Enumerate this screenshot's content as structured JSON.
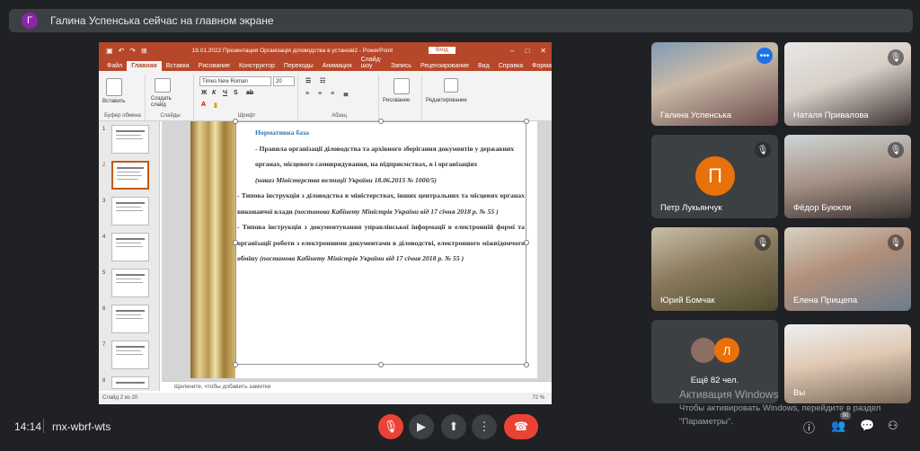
{
  "banner": {
    "avatar_letter": "Г",
    "text": "Галина Успенська сейчас на главном экране"
  },
  "powerpoint": {
    "title": "19.01.2022 Презентация Організація діловодства в установі2 - PowerPoint",
    "login_label": "Вход",
    "tabs": [
      "Файл",
      "Главная",
      "Вставка",
      "Рисование",
      "Конструктор",
      "Переходы",
      "Анимация",
      "Слайд-шоу",
      "Запись",
      "Рецензирование",
      "Вид",
      "Справка",
      "Формат"
    ],
    "active_tab": "Главная",
    "ribbon": {
      "paste_label": "Вставить",
      "clipboard_label": "Буфер обмена",
      "new_slide_label": "Создать слайд",
      "slides_label": "Слайды",
      "font_name": "Times New Roman",
      "font_size": "20",
      "font_label": "Шрифт",
      "paragraph_label": "Абзац",
      "drawing_label": "Рисование",
      "editing_label": "Редактирование"
    },
    "thumbnails": [
      "1",
      "2",
      "3",
      "4",
      "5",
      "6",
      "7",
      "8"
    ],
    "selected_slide": "2",
    "slide": {
      "heading": "Нормативна база",
      "p1": "- Правила організації діловодства та архівного зберігання документів у державних органах, місцевого самоврядування, на підприємствах, в і організаціях",
      "p1_italic": "(наказ Міністерства юстиції України 18.06.2015 № 1000/5)",
      "p2": "- Типова інструкція з діловодства в міністерствах, інших центральних та місцевих органах виконавчої влади",
      "p2_italic": "(постанова Кабінету Міністрів України від 17 січня 2018 р. № 55 )",
      "p3": "- Типова інструкція з документування управлінської інформації в електронній формі та організації роботи з електронними документами в діловодстві, електронного міжвідомчого обміну",
      "p3_italic": "(постанова Кабінету Міністрів України від 17 січня 2018 р. № 55 )"
    },
    "notes_placeholder": "Щелкните, чтобы добавить заметки",
    "status_text": "Слайд 2 из 20",
    "zoom": "72 %"
  },
  "participants": [
    {
      "name": "Галина Успенська",
      "state": "presenting"
    },
    {
      "name": "Наталя Привалова",
      "state": "muted"
    },
    {
      "name": "Петр Лукьянчук",
      "avatar": "П",
      "state": "muted"
    },
    {
      "name": "Фёдор Буюкли",
      "state": "muted"
    },
    {
      "name": "Юрий Бомчак",
      "state": "muted"
    },
    {
      "name": "Елена Прищепа",
      "state": "muted"
    },
    {
      "name": "Ещё 82 чел.",
      "avatar": "Л"
    },
    {
      "name": "Вы"
    }
  ],
  "watermark": {
    "line1": "Активация Windows",
    "line2": "Чтобы активировать Windows, перейдите в раздел",
    "line3": "\"Параметры\"."
  },
  "bottom": {
    "time": "14:14",
    "meeting_code": "rnx-wbrf-wts",
    "people_count": "90"
  },
  "colors": {
    "ppt_accent": "#b7472a",
    "meet_bg": "#202124",
    "end_call": "#ea4335",
    "avatar_orange": "#e8710a"
  }
}
